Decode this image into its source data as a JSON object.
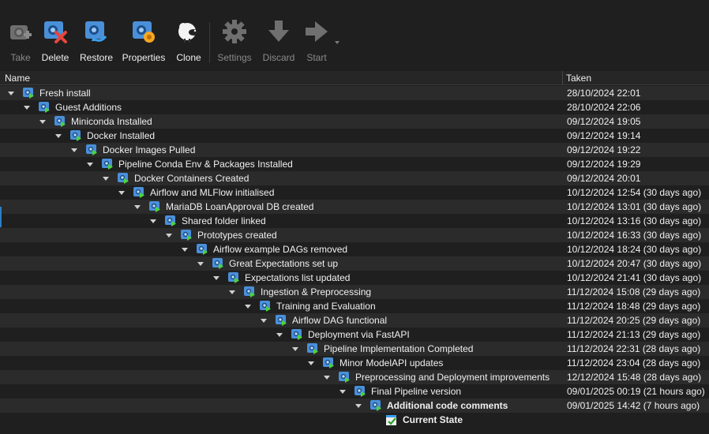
{
  "toolbar": {
    "buttons": [
      {
        "label": "Take",
        "icon": "take-snapshot-icon",
        "enabled": false
      },
      {
        "label": "Delete",
        "icon": "delete-snapshot-icon",
        "enabled": true
      },
      {
        "label": "Restore",
        "icon": "restore-snapshot-icon",
        "enabled": true
      },
      {
        "label": "Properties",
        "icon": "properties-icon",
        "enabled": true
      },
      {
        "label": "Clone",
        "icon": "clone-sheep-icon",
        "enabled": true
      },
      {
        "label": "Settings",
        "icon": "gear-icon",
        "enabled": false
      },
      {
        "label": "Discard",
        "icon": "discard-arrow-down-icon",
        "enabled": false
      },
      {
        "label": "Start",
        "icon": "start-arrow-right-icon",
        "enabled": false
      }
    ]
  },
  "table": {
    "columns": {
      "name": "Name",
      "taken": "Taken"
    },
    "rows": [
      {
        "name": "Fresh install",
        "taken": "28/10/2024 22:01",
        "depth": 0
      },
      {
        "name": "Guest Additions",
        "taken": "28/10/2024 22:06",
        "depth": 1
      },
      {
        "name": "Miniconda Installed",
        "taken": "09/12/2024 19:05",
        "depth": 2
      },
      {
        "name": "Docker Installed",
        "taken": "09/12/2024 19:14",
        "depth": 3
      },
      {
        "name": "Docker Images Pulled",
        "taken": "09/12/2024 19:22",
        "depth": 4
      },
      {
        "name": "Pipeline Conda Env & Packages Installed",
        "taken": "09/12/2024 19:29",
        "depth": 5
      },
      {
        "name": "Docker Containers Created",
        "taken": "09/12/2024 20:01",
        "depth": 6
      },
      {
        "name": "Airflow and MLFlow initialised",
        "taken": "10/12/2024 12:54 (30 days ago)",
        "depth": 7
      },
      {
        "name": "MariaDB LoanApproval DB created",
        "taken": "10/12/2024 13:01 (30 days ago)",
        "depth": 8
      },
      {
        "name": "Shared folder linked",
        "taken": "10/12/2024 13:16 (30 days ago)",
        "depth": 9
      },
      {
        "name": "Prototypes created",
        "taken": "10/12/2024 16:33 (30 days ago)",
        "depth": 10
      },
      {
        "name": "Airflow example DAGs removed",
        "taken": "10/12/2024 18:24 (30 days ago)",
        "depth": 11
      },
      {
        "name": "Great Expectations set up",
        "taken": "10/12/2024 20:47 (30 days ago)",
        "depth": 12
      },
      {
        "name": "Expectations list updated",
        "taken": "10/12/2024 21:41 (30 days ago)",
        "depth": 13
      },
      {
        "name": "Ingestion & Preprocessing",
        "taken": "11/12/2024 15:08 (29 days ago)",
        "depth": 14
      },
      {
        "name": "Training and Evaluation",
        "taken": "11/12/2024 18:48 (29 days ago)",
        "depth": 15
      },
      {
        "name": "Airflow DAG functional",
        "taken": "11/12/2024 20:25 (29 days ago)",
        "depth": 16
      },
      {
        "name": "Deployment via FastAPI",
        "taken": "11/12/2024 21:13 (29 days ago)",
        "depth": 17
      },
      {
        "name": "Pipeline Implementation Completed",
        "taken": "11/12/2024 22:31 (28 days ago)",
        "depth": 18
      },
      {
        "name": "Minor ModelAPI updates",
        "taken": "11/12/2024 23:04 (28 days ago)",
        "depth": 19
      },
      {
        "name": "Preprocessing and Deployment improvements",
        "taken": "12/12/2024 15:48 (28 days ago)",
        "depth": 20
      },
      {
        "name": "Final Pipeline version",
        "taken": "09/01/2025 00:19 (21 hours ago)",
        "depth": 21
      },
      {
        "name": "Additional code comments",
        "taken": "09/01/2025 14:42 (7 hours ago)",
        "depth": 22,
        "bold": true
      },
      {
        "name": "Current State",
        "taken": "",
        "depth": 23,
        "bold": true,
        "current": true
      }
    ]
  }
}
